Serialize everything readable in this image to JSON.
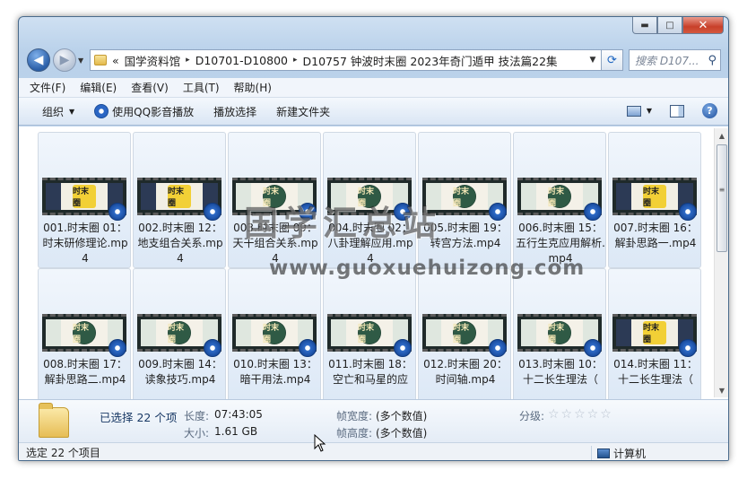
{
  "window": {
    "caption": {
      "min": "▬",
      "max": "□",
      "close": "✕"
    }
  },
  "navbar": {
    "back_icon": "◀",
    "forward_icon": "▶",
    "history_dropdown": "▼",
    "address": {
      "overflow": "«",
      "crumbs": [
        "国学资料馆",
        "D10701-D10800",
        "D10757 钟波时末圈 2023年奇门遁甲 技法篇22集"
      ],
      "separator": "▸",
      "dropdown_icon": "▼"
    },
    "refresh_icon": "⟳",
    "search": {
      "placeholder": "搜索 D107...",
      "icon": "⚲"
    }
  },
  "menu": [
    "文件(F)",
    "编辑(E)",
    "查看(V)",
    "工具(T)",
    "帮助(H)"
  ],
  "toolbar": {
    "organize": "组织",
    "play_qq": "使用QQ影音播放",
    "play_selection": "播放选择",
    "new_folder": "新建文件夹",
    "caret": "▼",
    "help": "?"
  },
  "files": [
    {
      "name": "001.时末圈 01：时末研修理论.mp4",
      "theme": "dark"
    },
    {
      "name": "002.时末圈 12：地支组合关系.mp4",
      "theme": "dark"
    },
    {
      "name": "003.时末圈 09：天干组合关系.mp4",
      "theme": "light"
    },
    {
      "name": "004.时末圈 02：八卦理解应用.mp4",
      "theme": "light"
    },
    {
      "name": "005.时末圈 19：转宫方法.mp4",
      "theme": "light"
    },
    {
      "name": "006.时末圈 15：五行生克应用解析.mp4",
      "theme": "light"
    },
    {
      "name": "007.时末圈 16：解卦思路一.mp4",
      "theme": "dark"
    },
    {
      "name": "008.时末圈 17：解卦思路二.mp4",
      "theme": "light"
    },
    {
      "name": "009.时末圈 14：读象技巧.mp4",
      "theme": "light"
    },
    {
      "name": "010.时末圈 13：暗干用法.mp4",
      "theme": "light"
    },
    {
      "name": "011.时末圈 18：空亡和马星的应",
      "theme": "light"
    },
    {
      "name": "012.时末圈 20：时间轴.mp4",
      "theme": "light"
    },
    {
      "name": "013.时末圈 10：十二长生理法（",
      "theme": "light"
    },
    {
      "name": "014.时末圈 11：十二长生理法（",
      "theme": "dark"
    }
  ],
  "thumb_label": {
    "light": "时末圈",
    "dark": "时末圈"
  },
  "details": {
    "selected": "已选择 22 个项",
    "length_label": "长度:",
    "length_value": "07:43:05",
    "size_label": "大小:",
    "size_value": "1.61 GB",
    "width_label": "帧宽度:",
    "width_value": "(多个数值)",
    "height_label": "帧高度:",
    "height_value": "(多个数值)",
    "rating_label": "分级:",
    "rating_stars": "☆☆☆☆☆"
  },
  "status": {
    "left": "选定 22 个项目",
    "right": "计算机"
  },
  "watermark": {
    "cn": "国学汇总站",
    "url": "www.guoxuehuizong.com"
  },
  "scroll": {
    "up": "▲",
    "down": "▼",
    "grip": "≡"
  }
}
